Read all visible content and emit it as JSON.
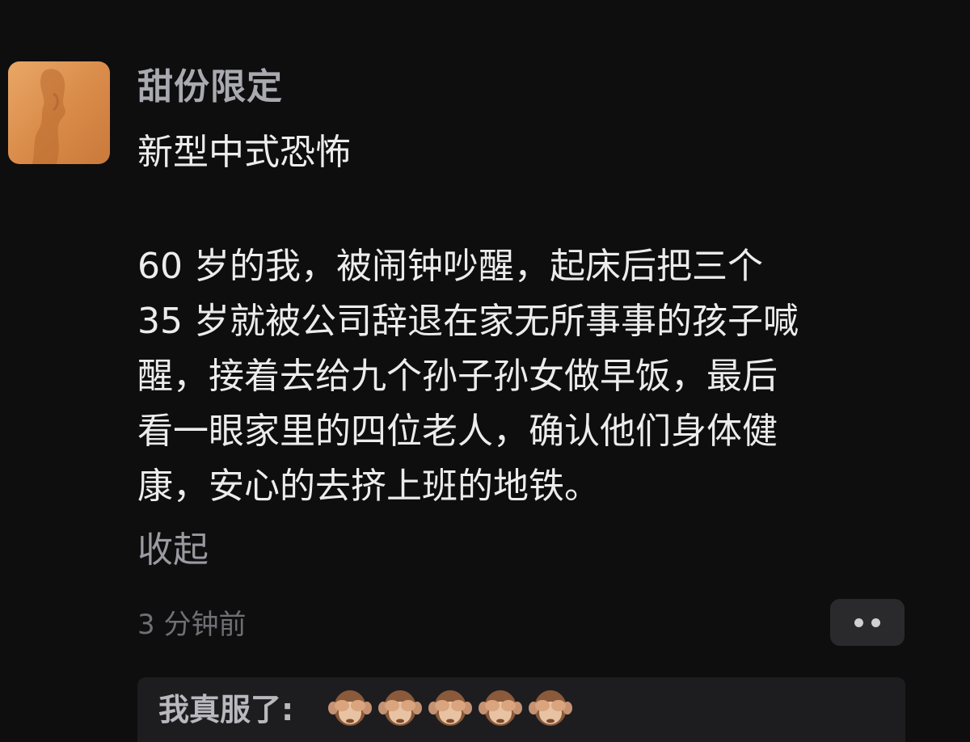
{
  "post": {
    "username": "甜份限定",
    "headline": "新型中式恐怖",
    "body_lines": [
      "60 岁的我，被闹钟吵醒，起床后把三个",
      "35 岁就被公司辞退在家无所事事的孩子喊",
      "醒，接着去给九个孙子孙女做早饭，最后",
      "看一眼家里的四位老人，确认他们身体健",
      "康，安心的去挤上班的地铁。"
    ],
    "collapse_label": "收起",
    "timestamp": "3 分钟前",
    "more_icon": "more-dots-icon"
  },
  "comment": {
    "author_prefix": "我真服了:",
    "emojis": [
      "see-no-evil-monkey",
      "see-no-evil-monkey",
      "see-no-evil-monkey",
      "see-no-evil-monkey",
      "see-no-evil-monkey"
    ]
  },
  "colors": {
    "background": "#0e0e0f",
    "username": "#a9a9b0",
    "text": "#ececec",
    "muted": "#6f6f74",
    "comment_bg": "#1d1d20"
  }
}
